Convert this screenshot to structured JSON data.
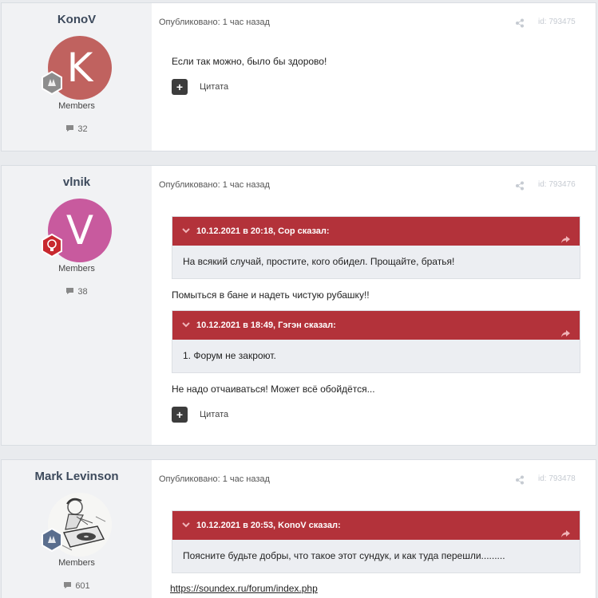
{
  "posts": [
    {
      "author": "KonoV",
      "avatar_letter": "K",
      "avatar_color": "#c0625f",
      "rank_color": "#8d8d8d",
      "group": "Members",
      "post_count": "32",
      "meta": "Опубликовано: 1 час назад",
      "id": "id: 793475",
      "body": "Если так можно, было бы здорово!",
      "quote_btn": "Цитата"
    },
    {
      "author": "vlnik",
      "avatar_letter": "V",
      "avatar_color": "#c85a9e",
      "rank_color": "#c8282e",
      "group": "Members",
      "post_count": "38",
      "meta": "Опубликовано: 1 час назад",
      "id": "id: 793476",
      "quotes": [
        {
          "header": "10.12.2021 в 20:18, Сор сказал:",
          "text": "На всякий случай, простите, кого обидел. Прощайте, братья!"
        },
        {
          "header": "10.12.2021 в 18:49, Гэгэн сказал:",
          "text": "1. Форум не закроют."
        }
      ],
      "paragraphs": [
        "Помыться в бане и надеть чистую рубашку!!",
        "Не надо отчаиваться!  Может всё обойдётся..."
      ],
      "quote_btn": "Цитата"
    },
    {
      "author": "Mark Levinson",
      "rank_color": "#5a6e8e",
      "group": "Members",
      "post_count": "601",
      "meta": "Опубликовано: 1 час назад",
      "id": "id: 793478",
      "quotes": [
        {
          "header": "10.12.2021 в 20:53, KonoV сказал:",
          "text": "Поясните будьте добры, что такое этот сундук, и как туда перешли........."
        }
      ],
      "link": "https://soundex.ru/forum/index.php"
    }
  ]
}
